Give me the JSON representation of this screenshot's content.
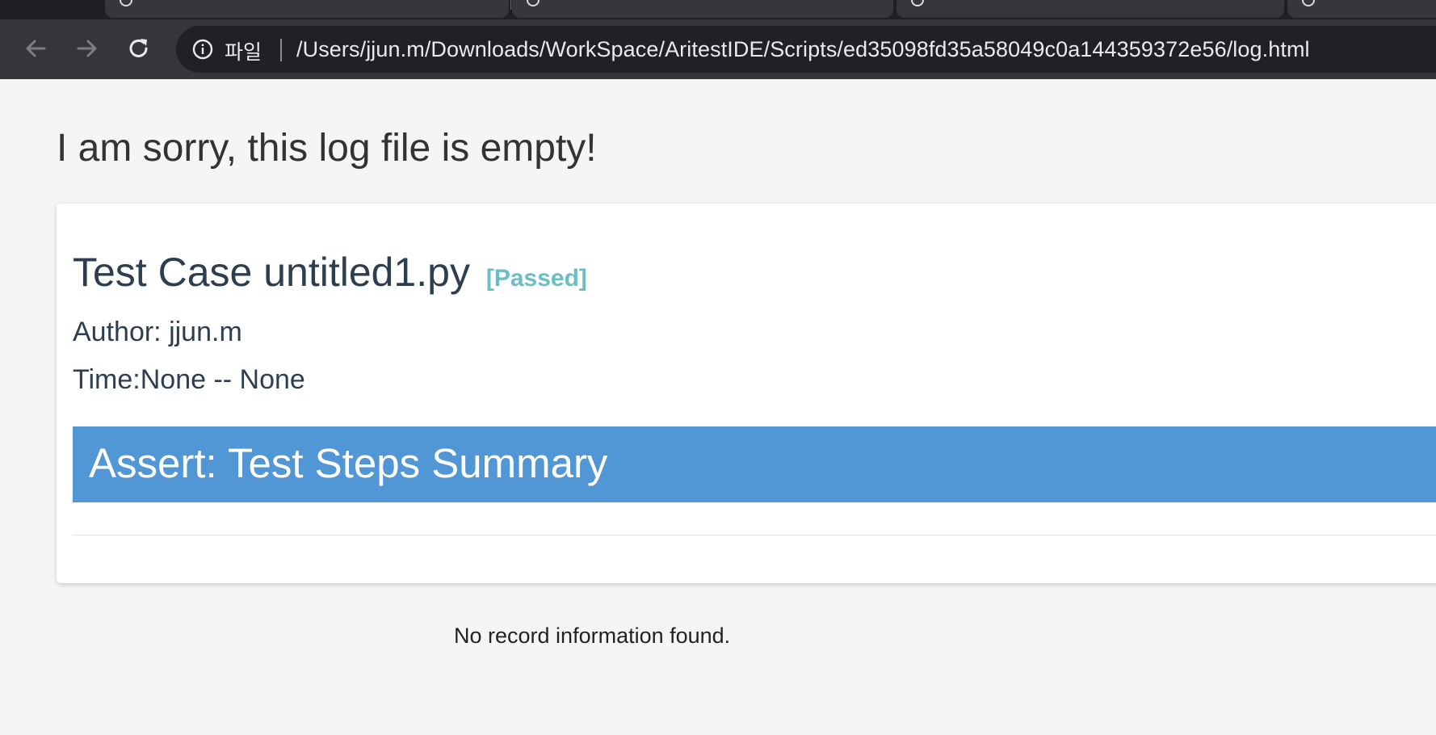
{
  "browser": {
    "address_bar": {
      "scheme_label": "파일",
      "url": "/Users/jjun.m/Downloads/WorkSpace/AritestIDE/Scripts/ed35098fd35a58049c0a144359372e56/log.html"
    },
    "icons": {
      "back": "arrow-left-icon",
      "forward": "arrow-right-icon",
      "reload": "reload-icon",
      "info": "info-icon"
    }
  },
  "page": {
    "heading": "I am sorry, this log file is empty!",
    "card": {
      "title": "Test Case untitled1.py",
      "status": "[Passed]",
      "author": "Author: jjun.m",
      "time": "Time:None -- None",
      "summary_title": "Assert: Test Steps Summary"
    },
    "no_record": "No record information found."
  },
  "colors": {
    "chrome_dark": "#35363a",
    "omnibox": "#202124",
    "status_passed": "#6cbdc5",
    "summary_bar": "#5197d5",
    "title_text": "#2c3e50"
  }
}
